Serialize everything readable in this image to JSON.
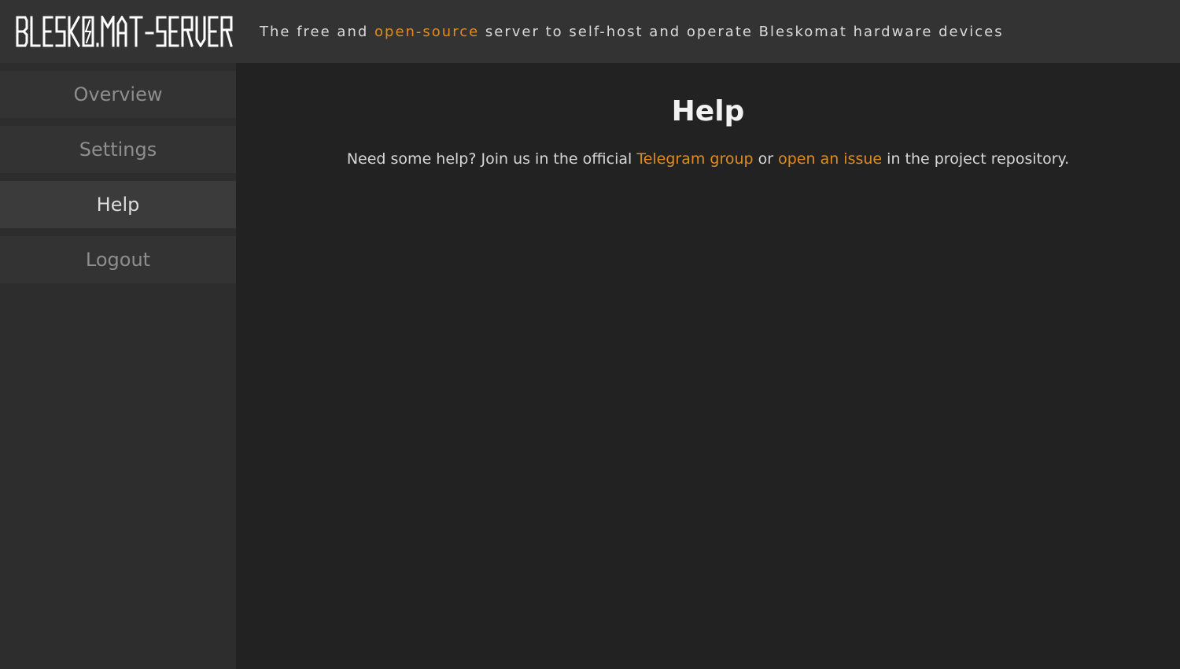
{
  "header": {
    "logo_text": "BLESKOMAT-SERVER",
    "tagline_prefix": "The free and ",
    "tagline_link": "open-source",
    "tagline_suffix": " server to self-host and operate Bleskomat hardware devices"
  },
  "sidebar": {
    "items": [
      {
        "label": "Overview"
      },
      {
        "label": "Settings"
      },
      {
        "label": "Help",
        "active": true
      },
      {
        "label": "Logout"
      }
    ]
  },
  "main": {
    "title": "Help",
    "text_before": "Need some help? Join us in the official ",
    "telegram_link": "Telegram group",
    "text_middle": " or ",
    "issue_link": "open an issue",
    "text_after": " in the project repository."
  },
  "colors": {
    "accent": "#e28b1c",
    "header_bg": "#333333",
    "sidebar_bg": "#2d2d2d",
    "main_bg": "#222222"
  }
}
